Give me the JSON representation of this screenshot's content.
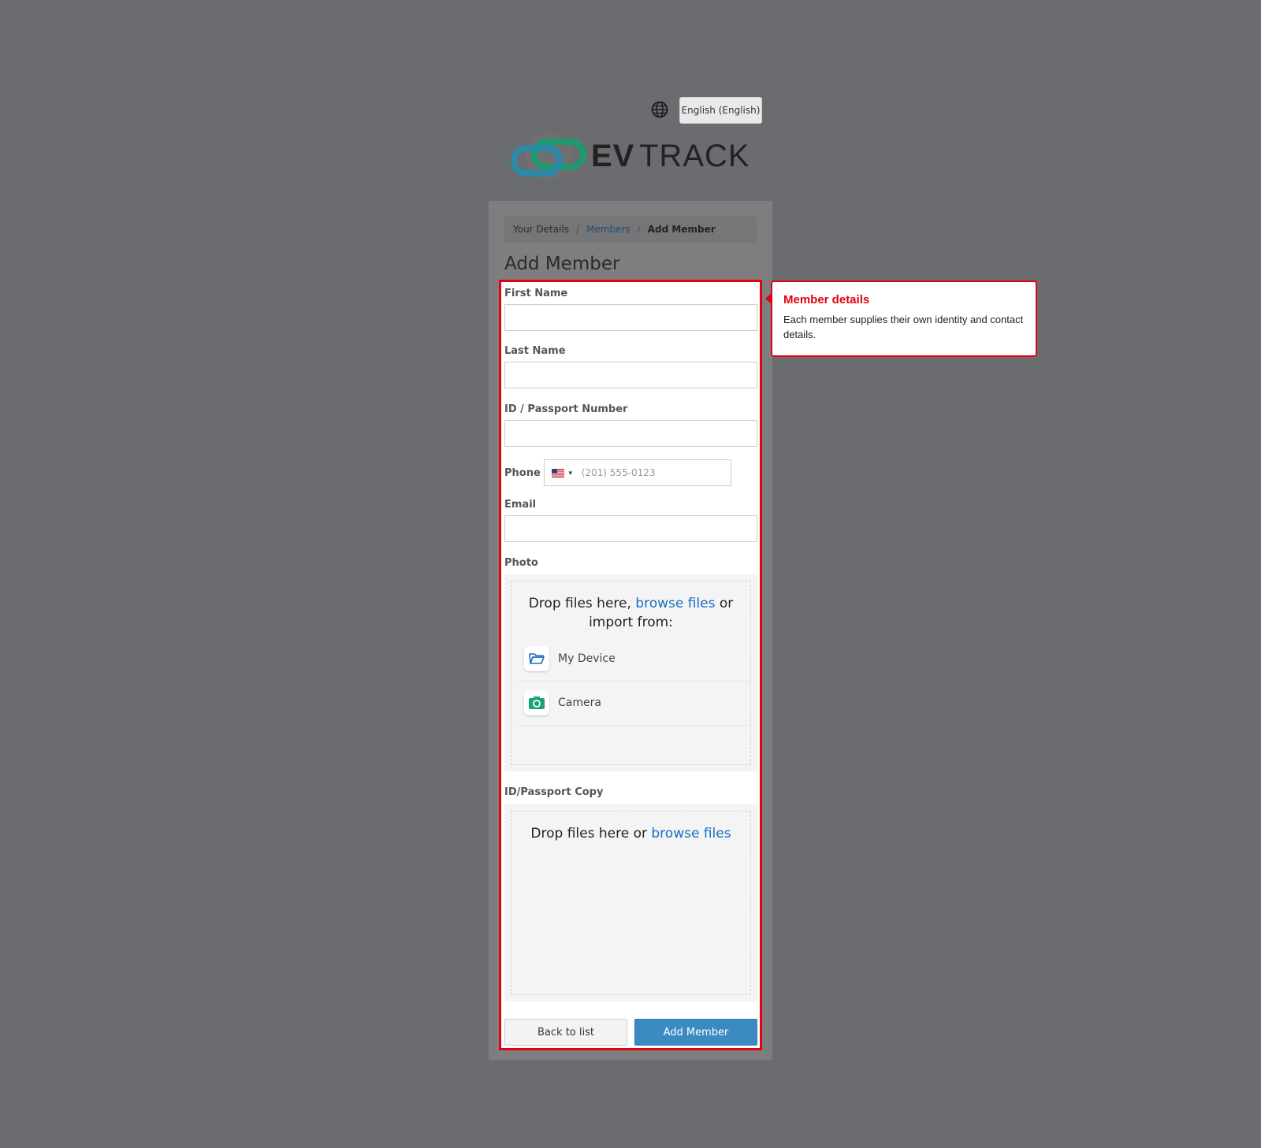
{
  "header": {
    "language_icon": "globe-icon",
    "language_label": "English (English)",
    "logo_text": "EVTRACK",
    "logo_colors": {
      "teal": "#2a8aa8",
      "green": "#1f9a6e",
      "dark": "#222222"
    }
  },
  "breadcrumb": {
    "items": [
      "Your Details",
      "Members",
      "Add Member"
    ],
    "separator": "/"
  },
  "page": {
    "title": "Add Member"
  },
  "form": {
    "first_name_label": "First Name",
    "last_name_label": "Last Name",
    "id_label": "ID / Passport Number",
    "phone_label": "Phone",
    "phone_placeholder": "(201) 555-0123",
    "phone_country": "US",
    "email_label": "Email",
    "photo_label": "Photo",
    "photo_drop_prefix": "Drop files here, ",
    "photo_drop_link": "browse files",
    "photo_drop_suffix": " or import from:",
    "photo_sources": [
      {
        "label": "My Device",
        "icon": "folder-icon"
      },
      {
        "label": "Camera",
        "icon": "camera-icon"
      }
    ],
    "id_copy_label": "ID/Passport Copy",
    "id_copy_drop_prefix": "Drop files here or ",
    "id_copy_drop_link": "browse files",
    "back_button": "Back to list",
    "submit_button": "Add Member"
  },
  "tooltip": {
    "title": "Member details",
    "body": "Each member supplies their own identity and contact details."
  },
  "colors": {
    "highlight": "#e3000f",
    "primary_button": "#3b8bc2",
    "link": "#1a6ec2"
  }
}
